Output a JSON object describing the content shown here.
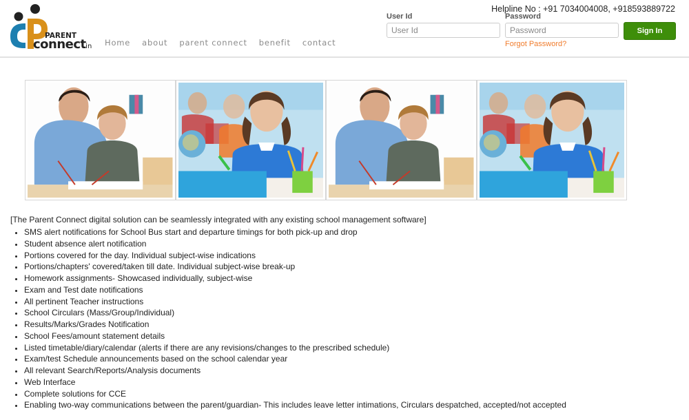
{
  "brand": {
    "top_word": "PARENT",
    "main_word": "connect",
    "suffix": ".in",
    "colors": {
      "blue": "#1d7fb0",
      "orange": "#d9901a",
      "dark": "#222222"
    }
  },
  "nav": {
    "items": [
      {
        "label": "Home"
      },
      {
        "label": "about"
      },
      {
        "label": "parent connect"
      },
      {
        "label": "benefit"
      },
      {
        "label": "contact"
      }
    ]
  },
  "login": {
    "helpline": "Helpline No : +91 7034004008, +918593889722",
    "user_label": "User Id",
    "user_placeholder": "User Id",
    "user_value": "",
    "password_label": "Password",
    "password_placeholder": "Password",
    "password_value": "",
    "signin_label": "Sign In",
    "forgot_label": "Forgot Password?",
    "signin_color": "#3e8e0a",
    "forgot_color": "#f07c2c"
  },
  "gallery": {
    "images": [
      {
        "alt": "teacher helping boy with writing"
      },
      {
        "alt": "smiling girl in classroom"
      },
      {
        "alt": "teacher helping boy with writing"
      },
      {
        "alt": "smiling girl in classroom"
      }
    ]
  },
  "content": {
    "intro": "[The Parent Connect digital solution can be seamlessly integrated with any existing school management software]",
    "features": [
      "SMS alert notifications for School Bus start and departure timings for both pick-up and drop",
      "Student absence alert notification",
      "Portions covered for the day. Individual subject-wise indications",
      "Portions/chapters' covered/taken till date. Individual subject-wise break-up",
      "Homework assignments- Showcased individually, subject-wise",
      "Exam and Test date notifications",
      "All pertinent Teacher instructions",
      "School Circulars (Mass/Group/Individual)",
      "Results/Marks/Grades Notification",
      "School Fees/amount statement details",
      "Listed timetable/diary/calendar (alerts if there are any revisions/changes to the prescribed schedule)",
      "Exam/test Schedule announcements based on the school calendar year",
      "All relevant Search/Reports/Analysis documents",
      "Web Interface",
      "Complete solutions for CCE",
      "Enabling two-way communications between the parent/guardian- This includes leave letter intimations, Circulars despatched, accepted/not accepted"
    ]
  }
}
